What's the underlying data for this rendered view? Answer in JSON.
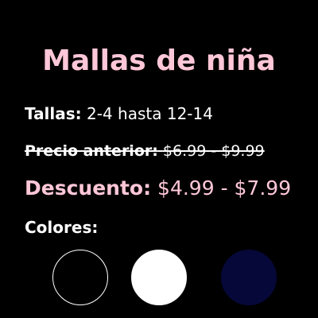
{
  "product": {
    "title": "Mallas de niña"
  },
  "sizes": {
    "label": "Tallas:",
    "value": "2-4 hasta 12-14"
  },
  "old_price": {
    "label": "Precio anterior:",
    "value": "$6.99 - $9.99"
  },
  "discount": {
    "label": "Descuento:",
    "value": "$4.99 - $7.99"
  },
  "colors": {
    "label": "Colores:",
    "swatches": [
      {
        "name": "black",
        "fill": "#000000",
        "border": "#ffffff"
      },
      {
        "name": "white",
        "fill": "#ffffff",
        "border": "#ffffff"
      },
      {
        "name": "navy",
        "fill": "#060839",
        "border": "#060839"
      }
    ]
  },
  "theme": {
    "background": "#000000",
    "text": "#ffffff",
    "accent_pink": "#ffc7d8"
  }
}
